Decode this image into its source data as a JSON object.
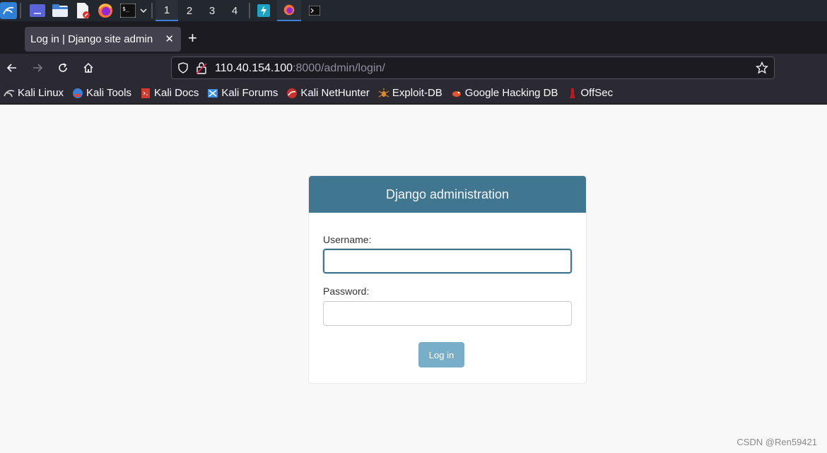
{
  "taskbar": {
    "workspaces": [
      "1",
      "2",
      "3",
      "4"
    ],
    "active_workspace": "1"
  },
  "browser": {
    "tab_title": "Log in | Django site admin",
    "tab_close": "✕",
    "new_tab": "+",
    "url_host": "110.40.154.100",
    "url_rest": ":8000/admin/login/"
  },
  "bookmarks": [
    {
      "label": "Kali Linux",
      "icon": "kali-dragon-icon"
    },
    {
      "label": "Kali Tools",
      "icon": "kali-tools-icon"
    },
    {
      "label": "Kali Docs",
      "icon": "kali-docs-icon"
    },
    {
      "label": "Kali Forums",
      "icon": "kali-forums-icon"
    },
    {
      "label": "Kali NetHunter",
      "icon": "nethunter-icon"
    },
    {
      "label": "Exploit-DB",
      "icon": "exploit-db-icon"
    },
    {
      "label": "Google Hacking DB",
      "icon": "ghdb-icon"
    },
    {
      "label": "OffSec",
      "icon": "offsec-icon"
    }
  ],
  "login": {
    "header": "Django administration",
    "username_label": "Username:",
    "username_value": "",
    "password_label": "Password:",
    "password_value": "",
    "submit_label": "Log in"
  },
  "watermark": "CSDN @Ren59421",
  "colors": {
    "header_bg": "#417690",
    "button_bg": "#79aec8",
    "page_bg": "#f8f8f8"
  }
}
